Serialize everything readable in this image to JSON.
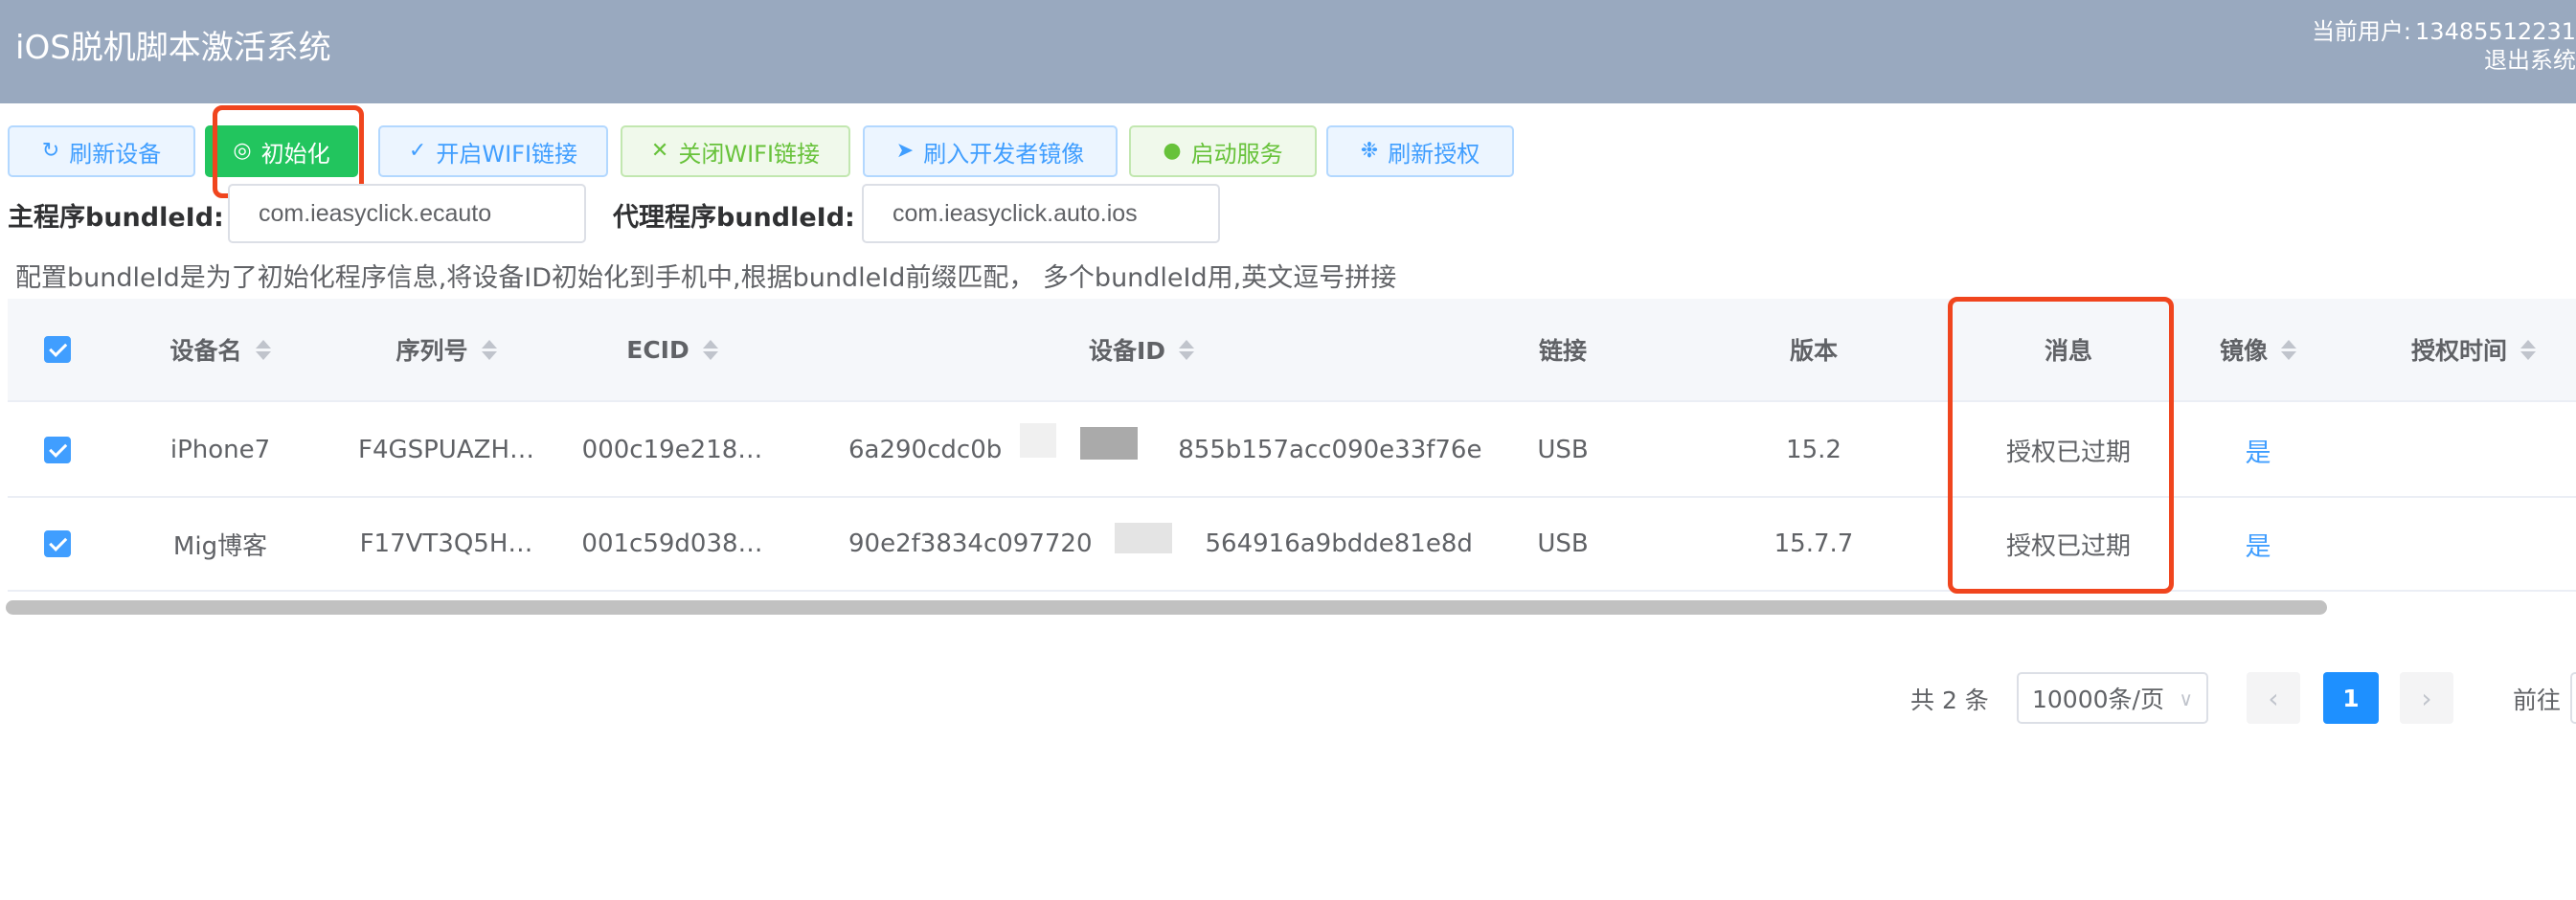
{
  "header": {
    "title": "iOS脱机脚本激活系统",
    "user_label": "当前用户:",
    "user_phone": "13485512231",
    "logout": "退出系统"
  },
  "toolbar": {
    "refresh_devices": "刷新设备",
    "initialize": "初始化",
    "enable_wifi": "开启WIFI链接",
    "disable_wifi": "关闭WIFI链接",
    "flash_dev_image": "刷入开发者镜像",
    "start_service": "启动服务",
    "refresh_auth": "刷新授权"
  },
  "bundle": {
    "main_label": "主程序bundleId:",
    "main_value": "com.ieasyclick.ecauto",
    "proxy_label": "代理程序bundleId:",
    "proxy_value": "com.ieasyclick.auto.ios",
    "hint": "配置bundleId是为了初始化程序信息,将设备ID初始化到手机中,根据bundleId前缀匹配， 多个bundleId用,英文逗号拼接"
  },
  "table": {
    "columns": {
      "device_name": "设备名",
      "serial": "序列号",
      "ecid": "ECID",
      "device_id": "设备ID",
      "link": "链接",
      "version": "版本",
      "message": "消息",
      "mirror": "镜像",
      "auth_time": "授权时间"
    },
    "rows": [
      {
        "device_name": "iPhone7",
        "serial": "F4GSPUAZH…",
        "ecid": "000c19e218…",
        "device_id_start": "6a290cdc0b",
        "device_id_end": "855b157acc090e33f76e",
        "link": "USB",
        "version": "15.2",
        "message": "授权已过期",
        "mirror": "是"
      },
      {
        "device_name": "Mig博客",
        "serial": "F17VT3Q5H…",
        "ecid": "001c59d038…",
        "device_id_start": "90e2f3834c097720",
        "device_id_end": "564916a9bdde81e8d",
        "link": "USB",
        "version": "15.7.7",
        "message": "授权已过期",
        "mirror": "是"
      }
    ]
  },
  "pagination": {
    "total": "共 2 条",
    "page_size": "10000条/页",
    "current_page": "1",
    "goto_label": "前往"
  },
  "colors": {
    "header_bg": "#99a9bf",
    "primary": "#409eff",
    "success": "#22c55e",
    "highlight": "#f0451e"
  }
}
